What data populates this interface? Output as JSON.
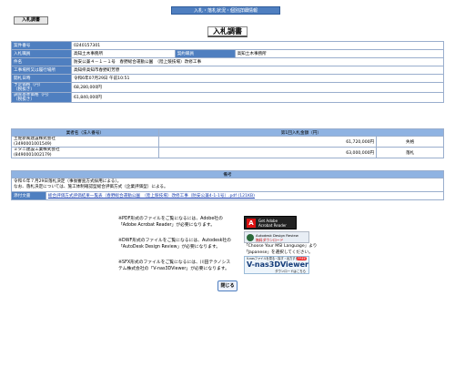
{
  "header": {
    "title": "入札・落札状況・個別詳細情報"
  },
  "tab": {
    "label": "入札調書"
  },
  "page_title": "入札調書",
  "info": [
    {
      "label": "案件番号",
      "value": "0240157301"
    },
    {
      "label": "入札職員",
      "value": "高知土木事務所",
      "label2": "契約職員",
      "value2": "高知土木事務所"
    },
    {
      "label": "件名",
      "value": "防安公兼４－１－１号　春野総合運動公園　（陸上競技場）改修工事"
    },
    {
      "label": "工事場所又は履行場所",
      "value": "高知県高知市春野町芳原"
    },
    {
      "label": "開札日時",
      "value": "令和6年07月29日 午前10:51"
    },
    {
      "label": "予定価格（円）",
      "label_sub": "（税抜き）",
      "value": "68,280,000円"
    },
    {
      "label": "調査基準価格（円）",
      "label_sub": "（税抜き）",
      "value": "61,840,000円"
    }
  ],
  "bids": {
    "col_name": "業者名（法人番号）",
    "col_amount": "第1回入札金額（円）",
    "rows": [
      {
        "name": "土佐新風建設株式会社",
        "corp": "(3490001001549)",
        "amount": "61,720,000円",
        "result": "失格"
      },
      {
        "name": "ミタニ建設工業株式会社",
        "corp": "(8490001002179)",
        "amount": "63,000,000円",
        "result": "落札"
      }
    ]
  },
  "remarks": {
    "header": "備考",
    "line1": "令和６年７月29日落札決定（事後審査方式採用による）。",
    "line2": "なお、落札決定については、施工体制確認型総合評価方式（企業評価型）による。",
    "attach_label": "添付文書",
    "attach_link": "総合評価方式評価結果一覧表（春野総合運動公園　（陸上競技場）改修工事（防安公兼4-1-1号）.pdf (121KB)"
  },
  "notes": [
    {
      "text1": "※PDF形式のファイルをご覧になるには、Adobe社の",
      "text2": "「Adobe Acrobat Reader」が必要になります。"
    },
    {
      "text1": "※DWF形式のファイルをご覧になるには、Autodesk社の",
      "text2": "「AutoDesk Design Review」が必要になります。"
    },
    {
      "text1": "※SFX形式のファイルをご覧になるには、川田テクノシス",
      "text2": "テム株式会社の「V-nas3DViewer」が必要になります。"
    }
  ],
  "badges": {
    "adobe_line1": "Get Adobe",
    "adobe_line2": "Acrobat Reader",
    "autodesk_line1": "Autodesk Design Review",
    "autodesk_line2": "無料ダウンロード",
    "autodesk_note1": "「Choose Your MSI Language」より",
    "autodesk_note2": "「Japanese」を選択してください。",
    "vnas_top": "V-nasファイルを見る・探す・出力する",
    "vnas_free": "FREE",
    "vnas_main": "V-nas3DViewer",
    "vnas_sub": "ダウンロードはこちら"
  },
  "close_button": "閉じる",
  "colors": {
    "label_bg": "#4f7fc0",
    "header_bg": "#8fb3e2",
    "border": "#9aaecd"
  }
}
